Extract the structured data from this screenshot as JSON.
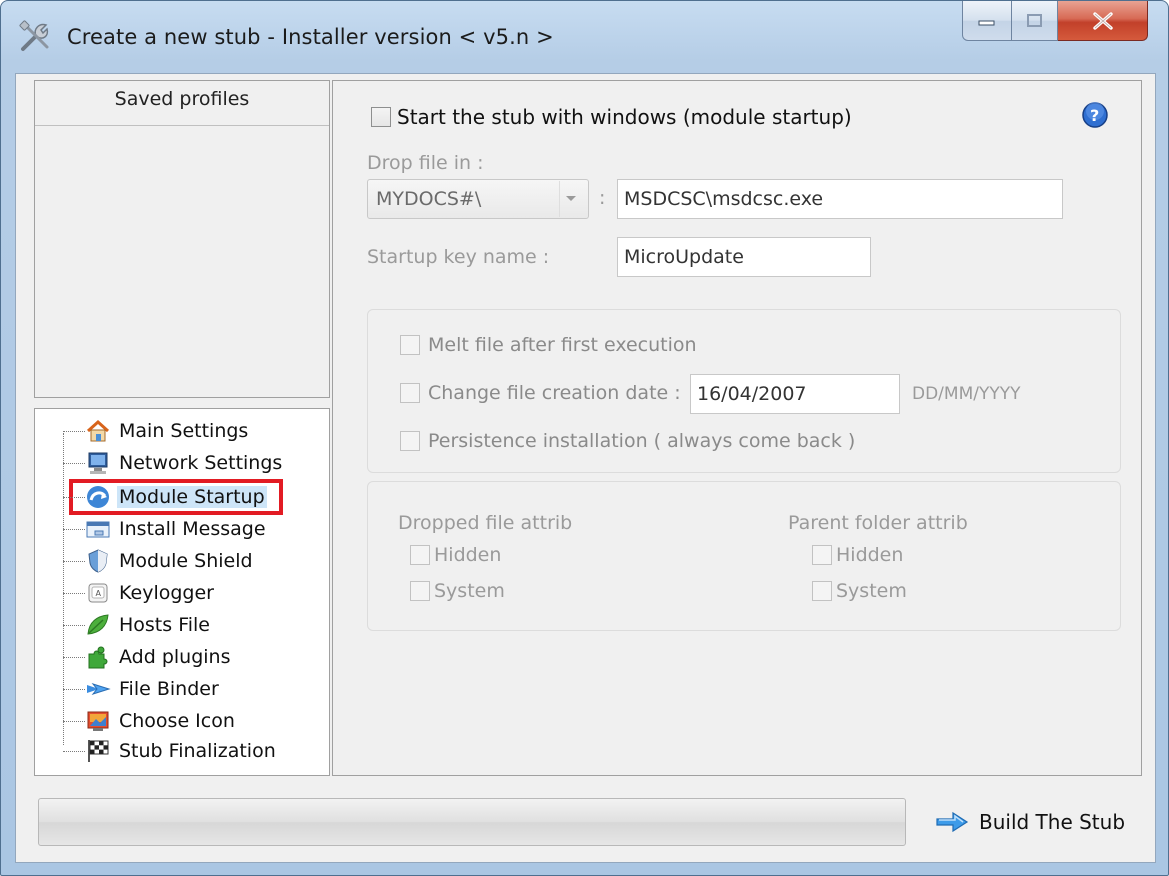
{
  "window": {
    "title": "Create a new stub - Installer version < v5.n >",
    "icon": "tools-icon",
    "buttons": {
      "minimize": "minimize-icon",
      "maximize": "maximize-icon",
      "close": "close-icon"
    }
  },
  "profiles": {
    "header": "Saved profiles"
  },
  "tree": {
    "items": [
      {
        "label": "Main Settings",
        "icon": "home-icon"
      },
      {
        "label": "Network Settings",
        "icon": "monitor-icon"
      },
      {
        "label": "Module Startup",
        "icon": "startup-arrow-icon",
        "selected": true
      },
      {
        "label": "Install Message",
        "icon": "message-box-icon"
      },
      {
        "label": "Module Shield",
        "icon": "shield-icon"
      },
      {
        "label": "Keylogger",
        "icon": "keyboard-key-icon"
      },
      {
        "label": "Hosts File",
        "icon": "leaf-icon"
      },
      {
        "label": "Add plugins",
        "icon": "puzzle-icon"
      },
      {
        "label": "File Binder",
        "icon": "double-arrow-icon"
      },
      {
        "label": "Choose Icon",
        "icon": "image-icon"
      },
      {
        "label": "Stub Finalization",
        "icon": "checkered-flag-icon"
      }
    ]
  },
  "startup": {
    "enable_label": "Start the stub with windows (module startup)",
    "drop_label": "Drop file in :",
    "drop_folder": "MYDOCS#\\",
    "separator": ":",
    "drop_path": "MSDCSC\\msdcsc.exe",
    "key_label": "Startup key name :",
    "key_name": "MicroUpdate",
    "help_icon": "help-icon"
  },
  "options": {
    "melt": "Melt file after first execution",
    "change_date": "Change file creation date :",
    "date_value": "16/04/2007",
    "date_format": "DD/MM/YYYY",
    "persistence": "Persistence installation ( always come back )"
  },
  "attribs": {
    "dropped_title": "Dropped file attrib",
    "parent_title": "Parent folder attrib",
    "hidden": "Hidden",
    "system": "System"
  },
  "footer": {
    "build_label": "Build The Stub",
    "build_icon": "arrow-right-icon"
  },
  "colors": {
    "selection_frame": "#e21b23",
    "selection_bg": "#cde5f8",
    "disabled_text": "#9a9a9a"
  }
}
